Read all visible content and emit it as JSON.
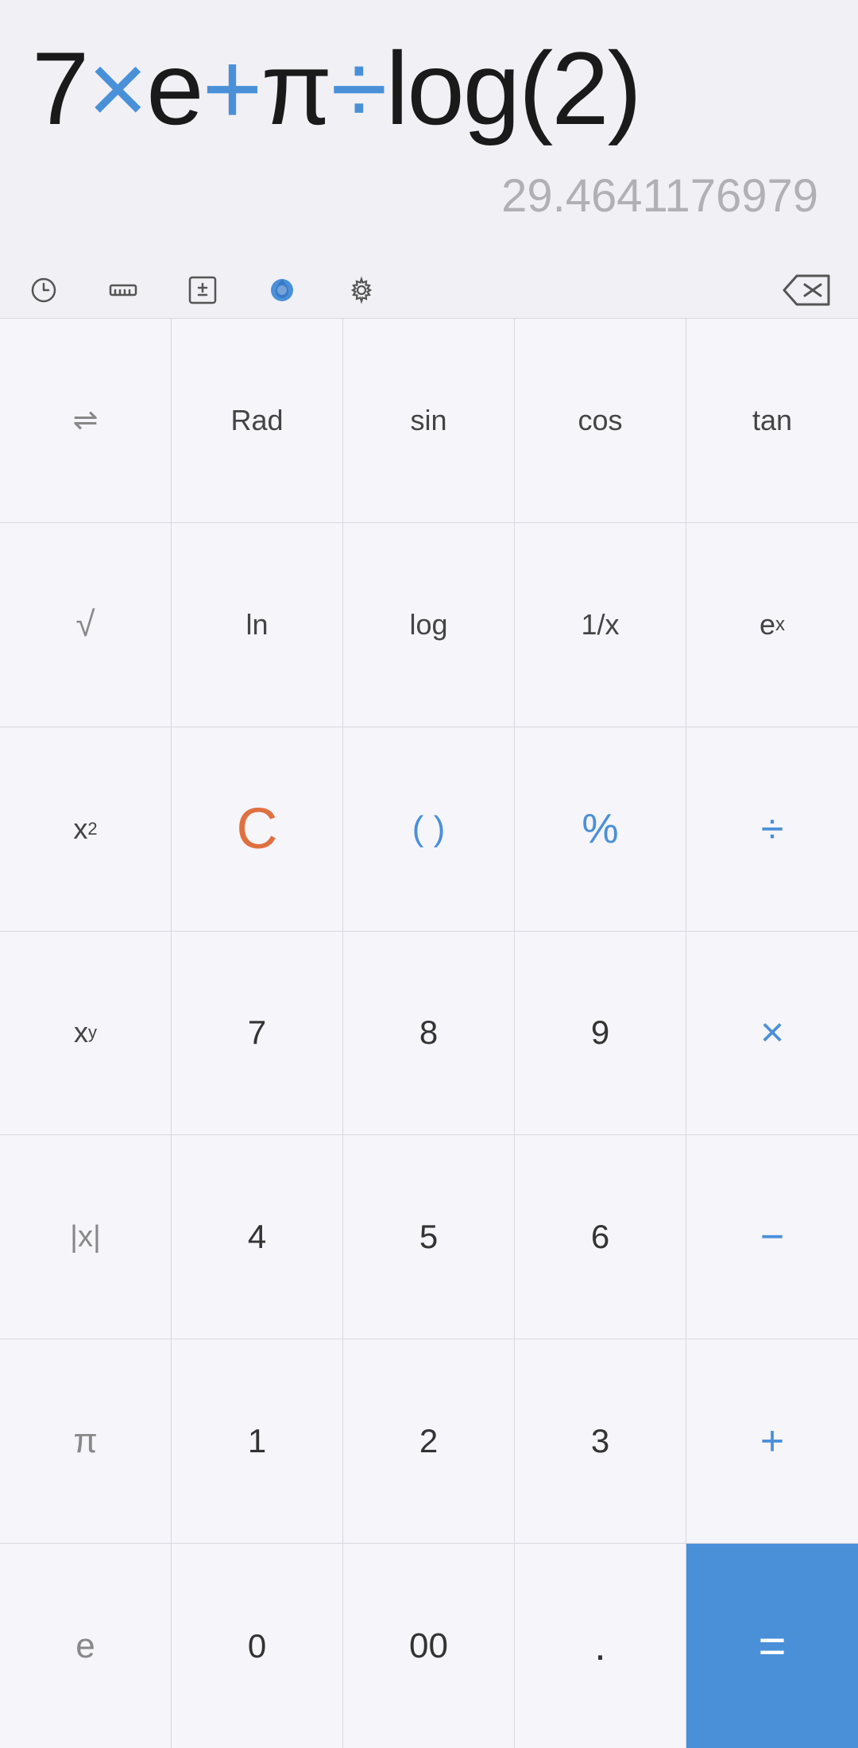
{
  "display": {
    "expression_parts": [
      {
        "text": "7",
        "class": ""
      },
      {
        "text": "×",
        "class": "blue"
      },
      {
        "text": "e",
        "class": ""
      },
      {
        "text": "+",
        "class": "blue"
      },
      {
        "text": "π",
        "class": ""
      },
      {
        "text": "÷",
        "class": "blue"
      },
      {
        "text": "log(2)",
        "class": ""
      }
    ],
    "expression_text": "7×e+π÷log(2)",
    "result": "29.4641176979"
  },
  "toolbar": {
    "history_label": "history",
    "ruler_label": "ruler",
    "plusminus_label": "plus-minus",
    "theme_label": "theme",
    "settings_label": "settings",
    "backspace_label": "backspace"
  },
  "keypad": {
    "rows": [
      [
        {
          "label": "⇌",
          "class": "gray-text",
          "name": "shift-key"
        },
        {
          "label": "Rad",
          "class": "small-text",
          "name": "rad-key"
        },
        {
          "label": "sin",
          "class": "small-text",
          "name": "sin-key"
        },
        {
          "label": "cos",
          "class": "small-text",
          "name": "cos-key"
        },
        {
          "label": "tan",
          "class": "small-text",
          "name": "tan-key"
        }
      ],
      [
        {
          "label": "√",
          "class": "gray-text",
          "name": "sqrt-key"
        },
        {
          "label": "ln",
          "class": "small-text",
          "name": "ln-key"
        },
        {
          "label": "log",
          "class": "small-text",
          "name": "log-key"
        },
        {
          "label": "1/x",
          "class": "small-text",
          "name": "reciprocal-key"
        },
        {
          "label": "eˣ",
          "class": "small-text superscript-text",
          "name": "exp-key",
          "super": "x",
          "base": "e"
        }
      ],
      [
        {
          "label": "x²",
          "class": "small-text superscript-text",
          "name": "square-key",
          "super": "2",
          "base": "x"
        },
        {
          "label": "C",
          "class": "orange-text",
          "name": "clear-key"
        },
        {
          "label": "(  )",
          "class": "blue-text small-text",
          "name": "paren-key"
        },
        {
          "label": "%",
          "class": "blue-text",
          "name": "percent-key"
        },
        {
          "label": "÷",
          "class": "blue-text",
          "name": "divide-key"
        }
      ],
      [
        {
          "label": "xʸ",
          "class": "small-text superscript-text",
          "name": "power-key",
          "super": "y",
          "base": "x"
        },
        {
          "label": "7",
          "class": "dark-text",
          "name": "seven-key"
        },
        {
          "label": "8",
          "class": "dark-text",
          "name": "eight-key"
        },
        {
          "label": "9",
          "class": "dark-text",
          "name": "nine-key"
        },
        {
          "label": "×",
          "class": "blue-text",
          "name": "multiply-key"
        }
      ],
      [
        {
          "label": "|x|",
          "class": "small-text gray-text",
          "name": "abs-key"
        },
        {
          "label": "4",
          "class": "dark-text",
          "name": "four-key"
        },
        {
          "label": "5",
          "class": "dark-text",
          "name": "five-key"
        },
        {
          "label": "6",
          "class": "dark-text",
          "name": "six-key"
        },
        {
          "label": "−",
          "class": "blue-text",
          "name": "minus-key"
        }
      ],
      [
        {
          "label": "π",
          "class": "gray-text small-text",
          "name": "pi-key"
        },
        {
          "label": "1",
          "class": "dark-text",
          "name": "one-key"
        },
        {
          "label": "2",
          "class": "dark-text",
          "name": "two-key"
        },
        {
          "label": "3",
          "class": "dark-text",
          "name": "three-key"
        },
        {
          "label": "+",
          "class": "blue-text",
          "name": "plus-key"
        }
      ],
      [
        {
          "label": "e",
          "class": "gray-text small-text",
          "name": "euler-key"
        },
        {
          "label": "0",
          "class": "dark-text",
          "name": "zero-key"
        },
        {
          "label": "00",
          "class": "dark-text small-text",
          "name": "double-zero-key"
        },
        {
          "label": ".",
          "class": "dark-text",
          "name": "decimal-key"
        },
        {
          "label": "=",
          "class": "equals-key",
          "name": "equals-key"
        }
      ]
    ]
  },
  "colors": {
    "blue": "#4a90d9",
    "orange": "#e07040",
    "bg": "#f0f0f5",
    "key_bg": "#f5f5fa",
    "border": "#d8d8de",
    "text_dark": "#333333",
    "text_gray": "#888888",
    "text_result": "#b0b0b5"
  }
}
